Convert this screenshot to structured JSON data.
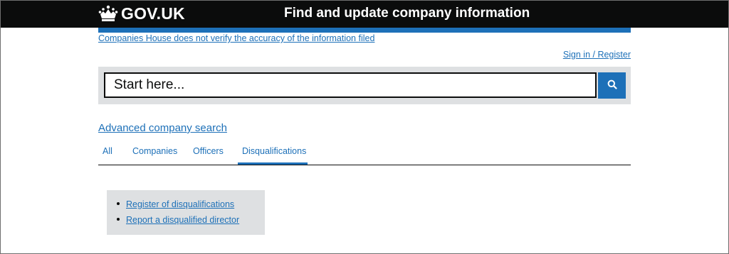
{
  "header": {
    "logo_text": "GOV.UK",
    "service_name": "Find and update company information"
  },
  "notice": {
    "disclaimer": "Companies House does not verify the accuracy of the information filed"
  },
  "account": {
    "signin_label": "Sign in / Register"
  },
  "search": {
    "placeholder": "Start here...",
    "value": ""
  },
  "advanced_search_label": "Advanced company search",
  "tabs": [
    {
      "label": "All",
      "active": false
    },
    {
      "label": "Companies",
      "active": false
    },
    {
      "label": "Officers",
      "active": false
    },
    {
      "label": "Disqualifications",
      "active": true
    }
  ],
  "disqualification_links": [
    {
      "label": "Register of disqualifications"
    },
    {
      "label": "Report a disqualified director"
    }
  ],
  "colors": {
    "header_bg": "#0b0c0c",
    "accent_blue": "#1d70b8",
    "panel_grey": "#dee0e2"
  },
  "icons": {
    "logo": "crown-icon",
    "search": "search-icon"
  }
}
